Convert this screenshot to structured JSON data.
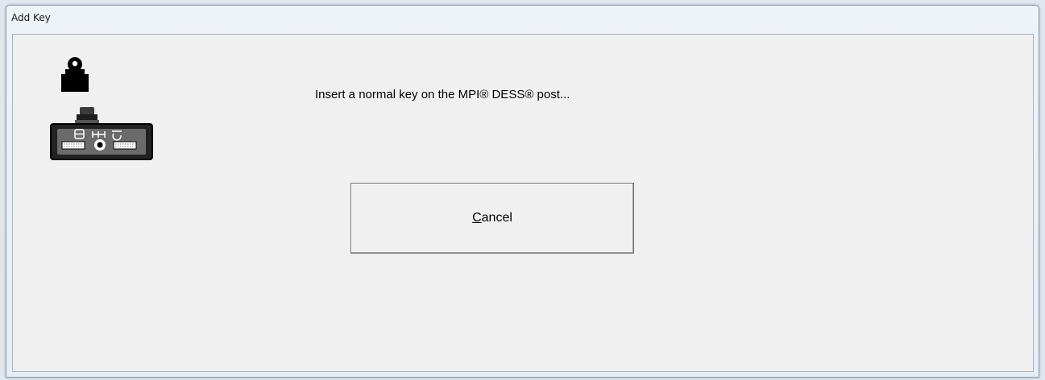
{
  "window": {
    "title": "Add Key"
  },
  "dialog": {
    "message": "Insert a normal key on the MPI® DESS® post...",
    "cancel_button": {
      "mnemonic": "C",
      "rest": "ancel"
    }
  },
  "icons": {
    "lock": "lock-icon",
    "device": "key-post-device-icon"
  }
}
